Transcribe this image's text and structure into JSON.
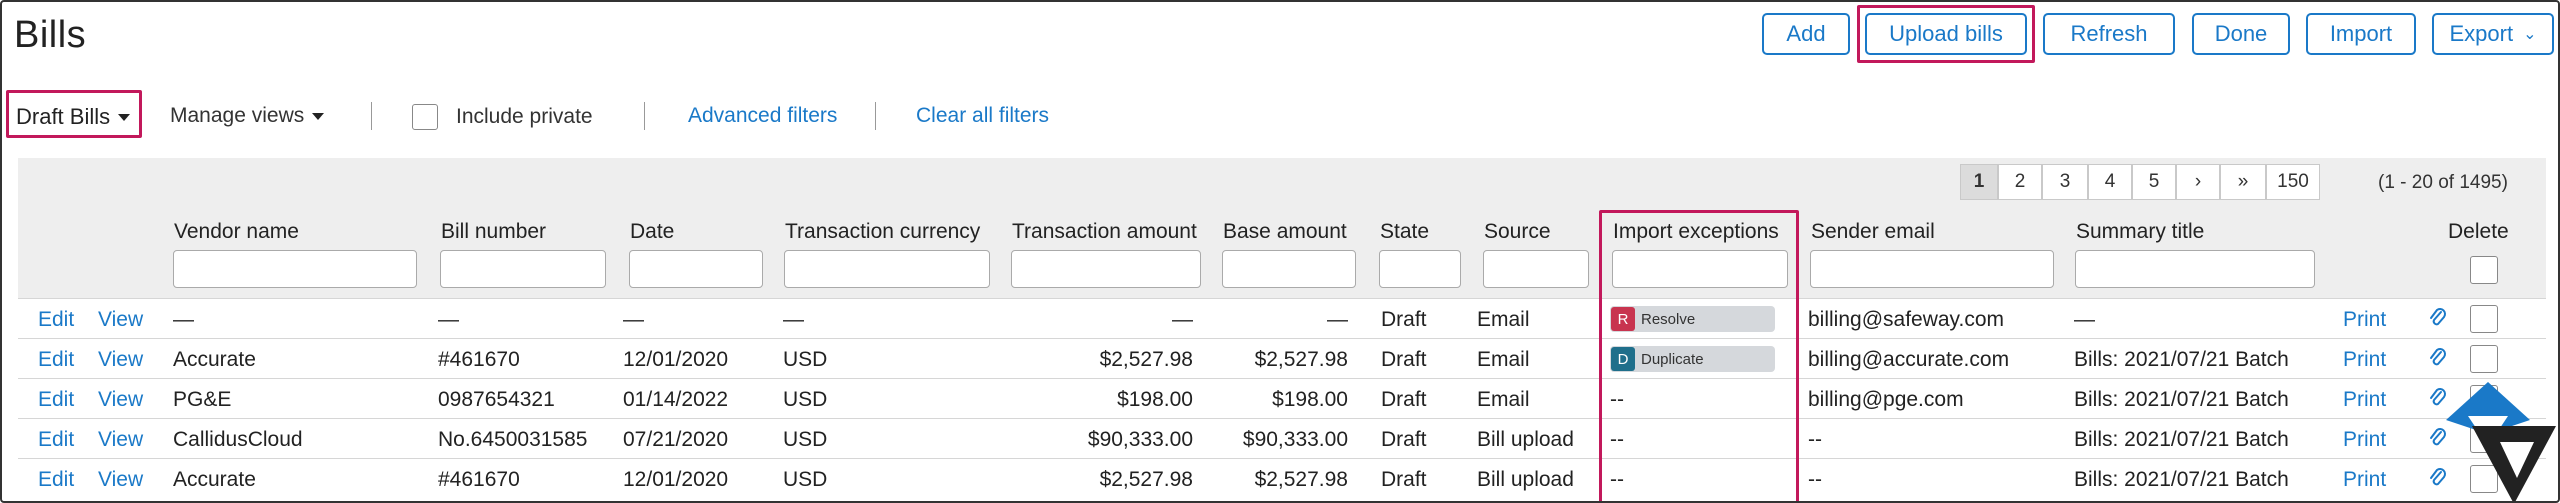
{
  "header": {
    "title": "Bills",
    "buttons": {
      "add": "Add",
      "upload_bills": "Upload bills",
      "refresh": "Refresh",
      "done": "Done",
      "import": "Import",
      "export": "Export"
    }
  },
  "filters": {
    "view_selector": "Draft Bills",
    "manage_views": "Manage views",
    "include_private": "Include private",
    "advanced_filters": "Advanced filters",
    "clear_all_filters": "Clear all filters"
  },
  "pagination": {
    "pages": [
      "1",
      "2",
      "3",
      "4",
      "5",
      "›",
      "»",
      "150"
    ],
    "current_page": "1",
    "summary": "(1 - 20 of 1495)"
  },
  "columns": {
    "vendor_name": "Vendor name",
    "bill_number": "Bill number",
    "date": "Date",
    "transaction_currency": "Transaction currency",
    "transaction_amount": "Transaction amount",
    "base_amount": "Base amount",
    "state": "State",
    "source": "Source",
    "import_exceptions": "Import exceptions",
    "sender_email": "Sender email",
    "summary_title": "Summary title",
    "delete": "Delete"
  },
  "row_actions": {
    "edit": "Edit",
    "view": "View",
    "print": "Print"
  },
  "rows": [
    {
      "vendor": "—",
      "bill_number": "—",
      "date": "—",
      "currency": "—",
      "transaction_amount": "—",
      "base_amount": "—",
      "state": "Draft",
      "source": "Email",
      "exception": "Resolve",
      "exception_letter": "R",
      "sender_email": "billing@safeway.com",
      "summary_title": "—"
    },
    {
      "vendor": "Accurate",
      "bill_number": "#461670",
      "date": "12/01/2020",
      "currency": "USD",
      "transaction_amount": "$2,527.98",
      "base_amount": "$2,527.98",
      "state": "Draft",
      "source": "Email",
      "exception": "Duplicate",
      "exception_letter": "D",
      "sender_email": "billing@accurate.com",
      "summary_title": "Bills: 2021/07/21 Batch"
    },
    {
      "vendor": "PG&E",
      "bill_number": "0987654321",
      "date": "01/14/2022",
      "currency": "USD",
      "transaction_amount": "$198.00",
      "base_amount": "$198.00",
      "state": "Draft",
      "source": "Email",
      "exception": "--",
      "sender_email": "billing@pge.com",
      "summary_title": "Bills: 2021/07/21 Batch"
    },
    {
      "vendor": "CallidusCloud",
      "bill_number": "No.6450031585",
      "date": "07/21/2020",
      "currency": "USD",
      "transaction_amount": "$90,333.00",
      "base_amount": "$90,333.00",
      "state": "Draft",
      "source": "Bill upload",
      "exception": "--",
      "sender_email": "--",
      "summary_title": "Bills: 2021/07/21 Batch"
    },
    {
      "vendor": "Accurate",
      "bill_number": "#461670",
      "date": "12/01/2020",
      "currency": "USD",
      "transaction_amount": "$2,527.98",
      "base_amount": "$2,527.98",
      "state": "Draft",
      "source": "Bill upload",
      "exception": "--",
      "sender_email": "--",
      "summary_title": "Bills: 2021/07/21 Batch"
    }
  ],
  "colors": {
    "accent": "#1a79c8",
    "highlight": "#c2185b",
    "resolve_badge": "#c8344f",
    "duplicate_badge": "#1f6f8b",
    "logo_blue": "#1a79c8"
  }
}
